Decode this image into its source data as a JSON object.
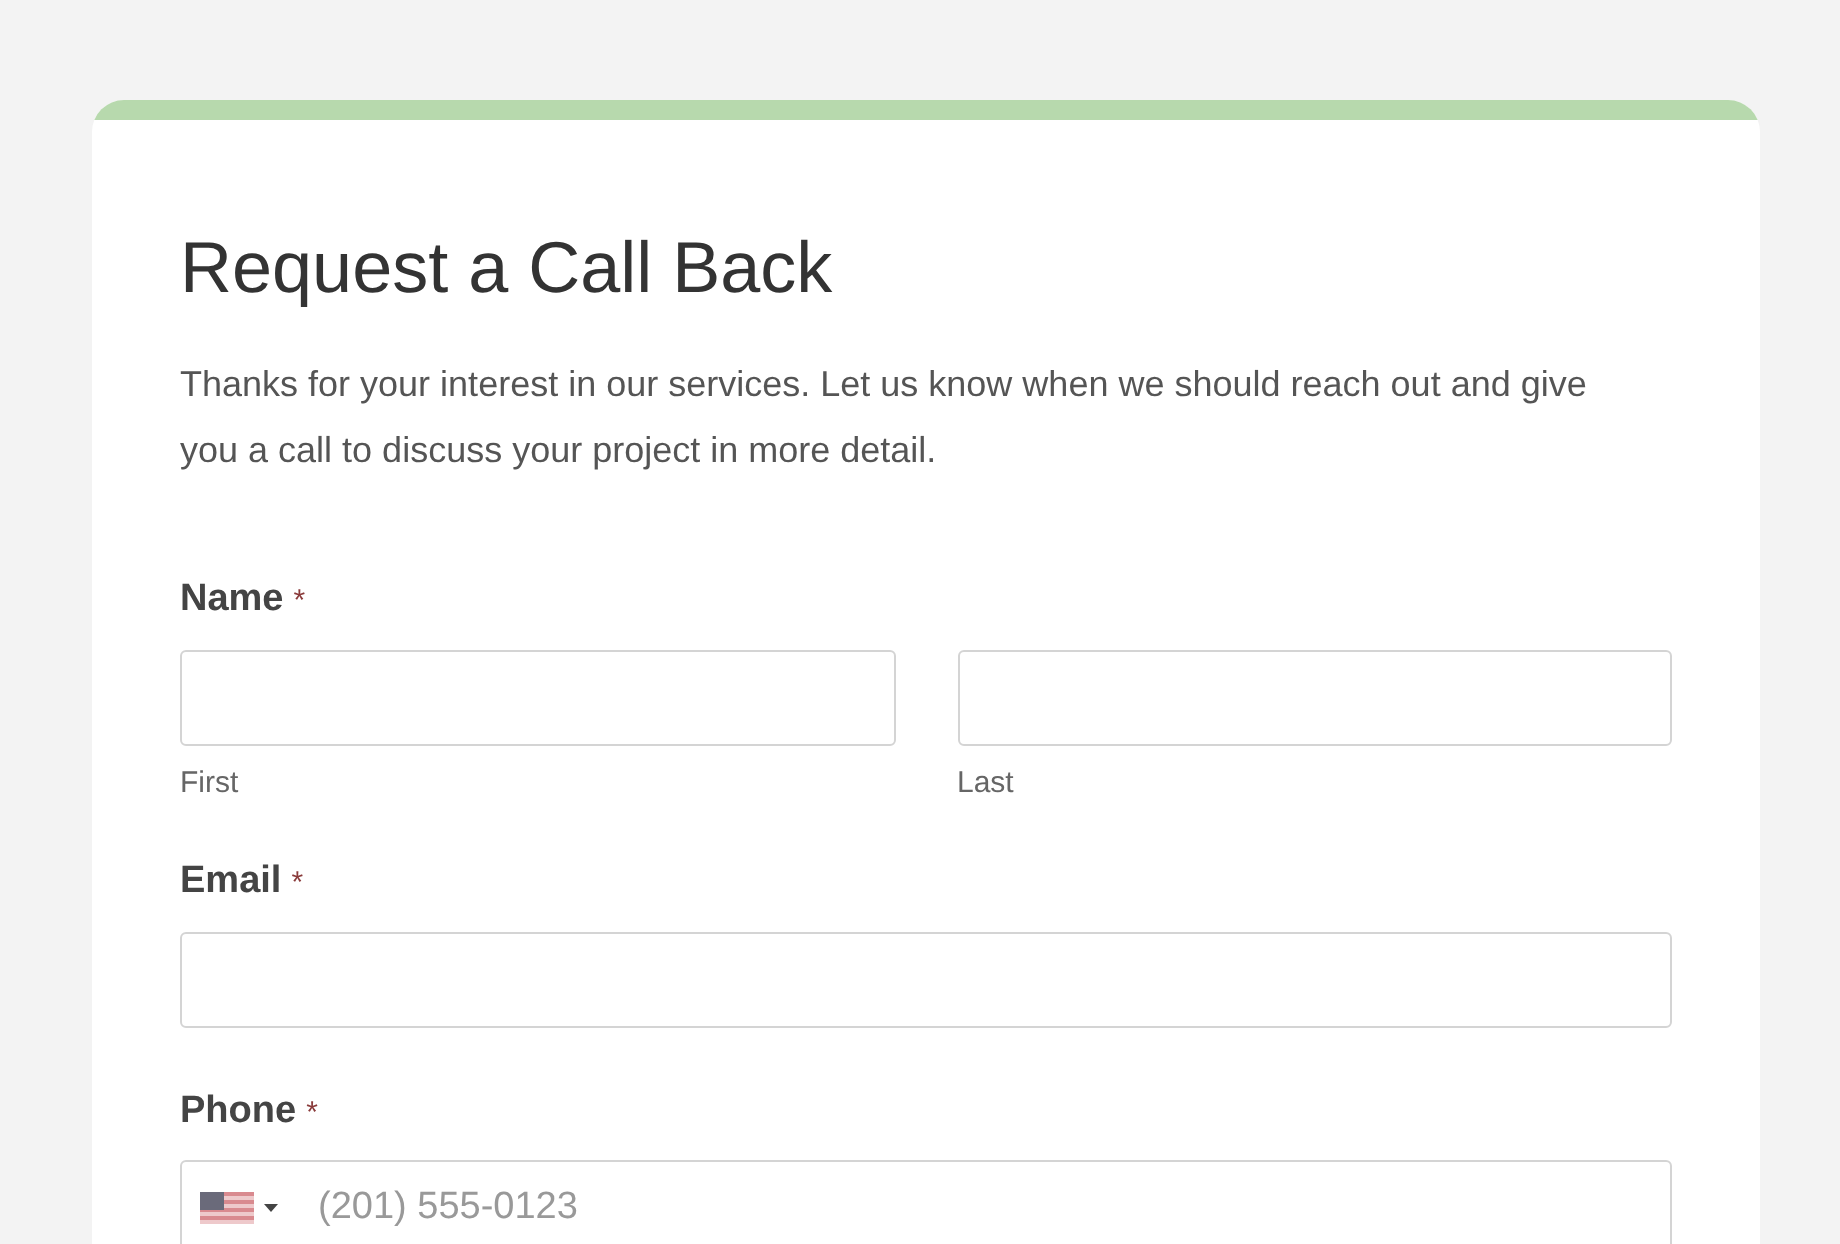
{
  "form": {
    "title": "Request a Call Back",
    "description": "Thanks for your interest in our services. Let us know when we should reach out and give you a call to discuss your project in more detail.",
    "fields": [
      {
        "kind": "name",
        "label": "Name",
        "required_mark": "*",
        "parts": [
          {
            "sublabel": "First"
          },
          {
            "sublabel": "Last"
          }
        ]
      },
      {
        "kind": "email",
        "label": "Email",
        "required_mark": "*"
      },
      {
        "kind": "phone",
        "label": "Phone",
        "required_mark": "*",
        "placeholder": "(201) 555-0123"
      }
    ]
  }
}
